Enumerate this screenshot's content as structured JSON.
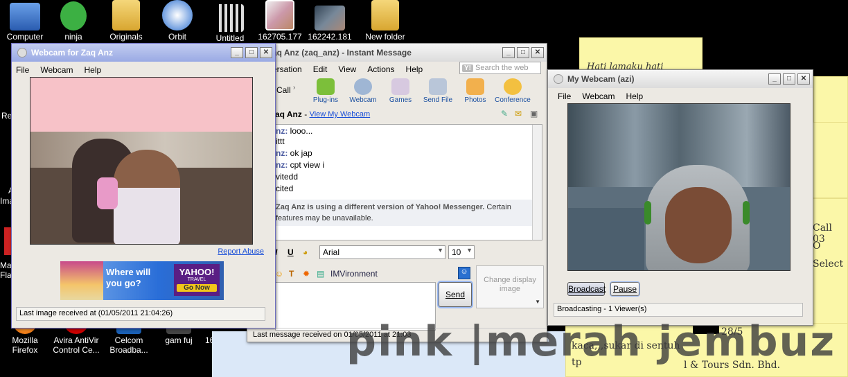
{
  "desktop_icons": [
    {
      "label": "Computer",
      "name": "computer-icon",
      "color": "#3a7bd5"
    },
    {
      "label": "ninja",
      "name": "ninja-icon",
      "color": "#3cb043"
    },
    {
      "label": "Originals",
      "name": "folder-icon",
      "color": "#e8c050"
    },
    {
      "label": "Orbit",
      "name": "orbit-icon",
      "color": "#f0f0f0"
    },
    {
      "label": "Untitled",
      "name": "document-icon",
      "color": "#ffffff"
    },
    {
      "label": "162705.177",
      "name": "image-thumb-icon",
      "color": "#c9a"
    },
    {
      "label": "162242.181",
      "name": "image-thumb-icon",
      "color": "#567"
    },
    {
      "label": "New folder",
      "name": "folder-icon",
      "color": "#e8c050"
    },
    {
      "label": "Mozilla\nFirefox",
      "name": "firefox-icon",
      "color": "#e66000"
    },
    {
      "label": "Avira AntiVir\nControl Ce...",
      "name": "avira-icon",
      "color": "#d00"
    },
    {
      "label": "Celcom\nBroadba...",
      "name": "celcom-icon",
      "color": "#1a5fb4"
    },
    {
      "label": "gam fuj",
      "name": "game-icon",
      "color": "#777"
    },
    {
      "label": "16",
      "name": "partial-icon",
      "color": "#333"
    }
  ],
  "left_edge_labels": [
    "Re",
    "A",
    "Ima",
    "Mac",
    "Flas"
  ],
  "webcam_zaq": {
    "title": "Webcam for Zaq Anz",
    "menu": [
      "File",
      "Webcam",
      "Help"
    ],
    "report_abuse": "Report Abuse",
    "ad": {
      "line1": "Where will",
      "line2": "you go?",
      "brand": "YAHOO!",
      "brand_sub": "TRAVEL",
      "cta": "Go Now"
    },
    "status": "Last image received at (01/05/2011 21:04:26)"
  },
  "im": {
    "title": "aq Anz (zaq_anz) - Instant Message",
    "menu": [
      "ersation",
      "Edit",
      "View",
      "Actions",
      "Help"
    ],
    "search_placeholder": "Search the web",
    "call_label": "Call",
    "tools": [
      {
        "label": "Plug-ins",
        "color": "#7cbf3a"
      },
      {
        "label": "Webcam",
        "color": "#9fb6d4"
      },
      {
        "label": "Games",
        "color": "#d7c9e0"
      },
      {
        "label": "Send File",
        "color": "#b9c6d9"
      },
      {
        "label": "Photos",
        "color": "#f2b04d"
      },
      {
        "label": "Conference",
        "color": "#f3c040"
      }
    ],
    "contact": "aq Anz",
    "view_webcam": "View My Webcam",
    "messages": [
      {
        "who": "nz:",
        "text": "looo..."
      },
      {
        "who": "",
        "text": "ittt"
      },
      {
        "who": "nz:",
        "text": "ok jap"
      },
      {
        "who": "nz:",
        "text": "cpt view i"
      },
      {
        "who": "",
        "text": "vitedd"
      },
      {
        "who": "",
        "text": "cited"
      }
    ],
    "notice_bold": "Zaq Anz is using a different version of Yahoo! Messenger.",
    "notice_rest": "Certain features may be unavailable.",
    "font_name": "Arial",
    "font_size": "10",
    "imvironment": "IMVironment",
    "change_display": "Change display image",
    "send": "Send",
    "status": "Last message received on 01/05/2011 at 21:03"
  },
  "my_webcam": {
    "title": "My Webcam (azi)",
    "menu": [
      "File",
      "Webcam",
      "Help"
    ],
    "broadcast": "Broadcast",
    "pause": "Pause",
    "status": "Broadcasting - 1 Viewer(s)"
  },
  "stickies": {
    "top": "Hati lamaku hati",
    "right1": "Call 03",
    "right2": "O",
    "right3": "Select",
    "date": "28/5",
    "note1": "kaca,,,sukar di sentuh",
    "note2": "tp",
    "note3": "l & Tours Sdn. Bhd."
  },
  "watermark": "pink |merah jembuz"
}
